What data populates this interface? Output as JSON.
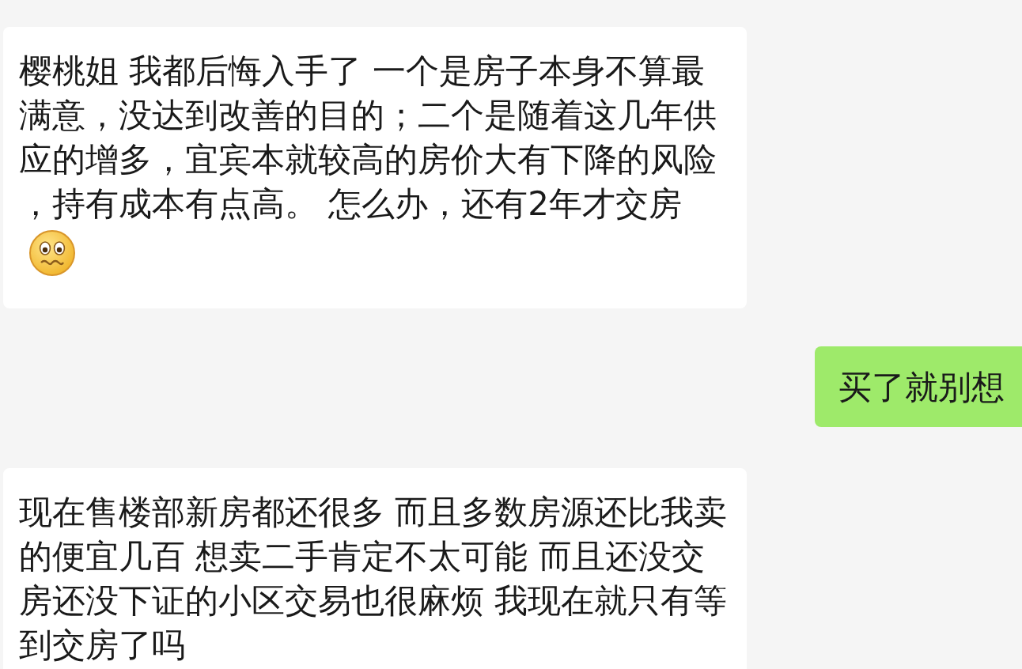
{
  "messages": [
    {
      "kind": "incoming",
      "text": "樱桃姐 我都后悔入手了 一个是房子本身不算最满意，没达到改善的目的；二个是随着这几年供应的增多，宜宾本就较高的房价大有下降的风险，持有成本有点高。 怎么办，还有2年才交房",
      "emoji": true
    },
    {
      "kind": "outgoing",
      "text": "买了就别想"
    },
    {
      "kind": "incoming",
      "text": "现在售楼部新房都还很多 而且多数房源还比我卖的便宜几百 想卖二手肯定不太可能 而且还没交房还没下证的小区交易也很麻烦 我现在就只有等到交房了吗"
    }
  ]
}
